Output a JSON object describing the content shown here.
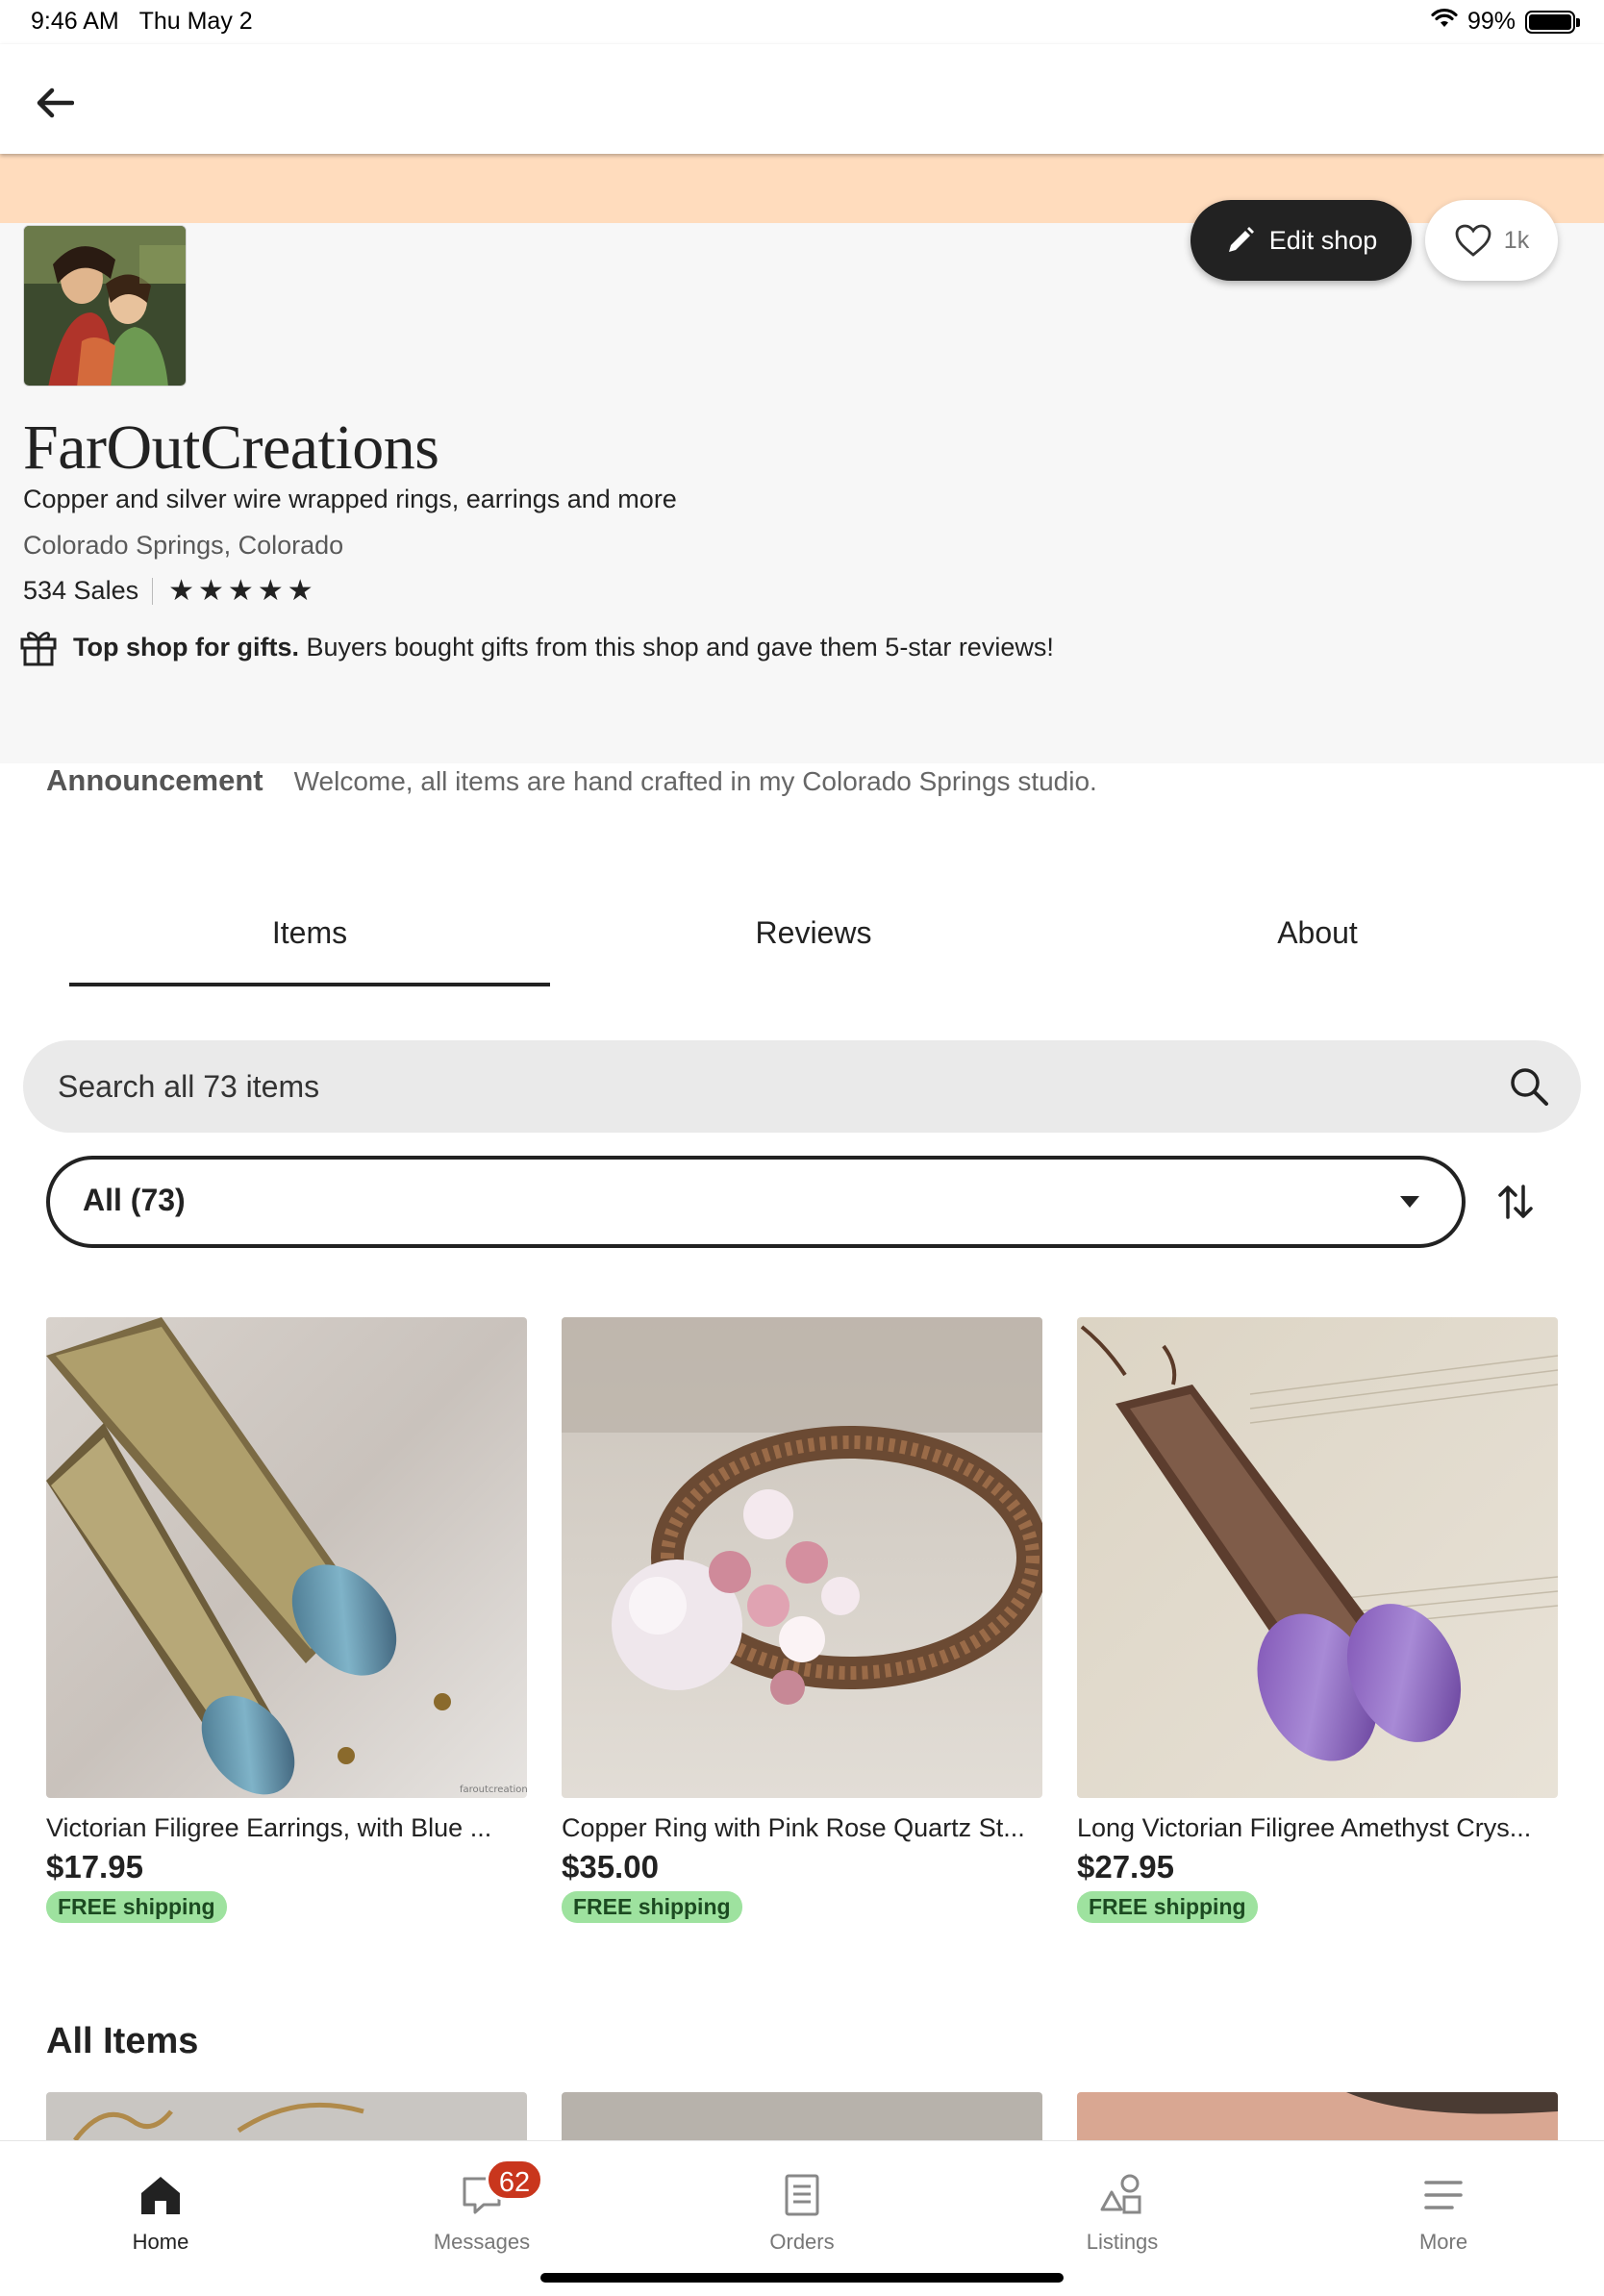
{
  "status_bar": {
    "time": "9:46 AM",
    "date": "Thu May 2",
    "battery": "99%"
  },
  "shop": {
    "name": "FarOutCreations",
    "tagline": "Copper and silver wire wrapped rings, earrings and more",
    "location": "Colorado Springs, Colorado",
    "sales": "534 Sales",
    "rating_stars": 5,
    "edit_label": "Edit shop",
    "favorites_count": "1k",
    "gift_bold": "Top shop for gifts.",
    "gift_text": " Buyers bought gifts from this shop and gave them 5-star reviews!",
    "banner_color": "#ffdcbd"
  },
  "announcement": {
    "title": "Announcement",
    "text": "Welcome, all items are hand crafted in my Colorado Springs studio."
  },
  "tabs": [
    {
      "label": "Items",
      "active": true
    },
    {
      "label": "Reviews",
      "active": false
    },
    {
      "label": "About",
      "active": false
    }
  ],
  "search": {
    "placeholder": "Search all 73 items"
  },
  "filter": {
    "selected": "All (73)"
  },
  "listings": [
    {
      "title": "Victorian Filigree Earrings, with Blue ...",
      "price": "$17.95",
      "badge": "FREE shipping",
      "watermark": "faroutcreations"
    },
    {
      "title": "Copper Ring with Pink Rose Quartz St...",
      "price": "$35.00",
      "badge": "FREE shipping"
    },
    {
      "title": "Long Victorian Filigree Amethyst Crys...",
      "price": "$27.95",
      "badge": "FREE shipping"
    }
  ],
  "all_items_title": "All Items",
  "bottom_nav": [
    {
      "label": "Home",
      "icon": "home-icon",
      "active": true
    },
    {
      "label": "Messages",
      "icon": "messages-icon",
      "badge": "62"
    },
    {
      "label": "Orders",
      "icon": "orders-icon"
    },
    {
      "label": "Listings",
      "icon": "listings-icon"
    },
    {
      "label": "More",
      "icon": "menu-icon"
    }
  ],
  "colors": {
    "accent_dark": "#222222",
    "free_shipping_bg": "#9ee29f",
    "badge_red": "#c9361d"
  }
}
